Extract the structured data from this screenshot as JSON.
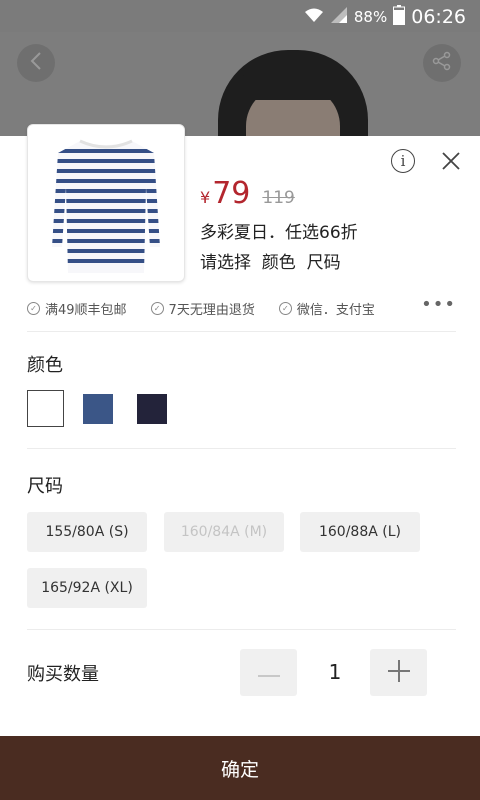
{
  "status_bar": {
    "battery": "88%",
    "time": "06:26"
  },
  "product": {
    "currency": "¥",
    "price": "79",
    "original_price": "119",
    "promo": "多彩夏日．任选66折",
    "selection_hint": "请选择  颜色  尺码"
  },
  "perks": [
    {
      "label": "满49顺丰包邮"
    },
    {
      "label": "7天无理由退货"
    },
    {
      "label": "微信．支付宝"
    }
  ],
  "more": "•••",
  "color_section": {
    "title": "颜色",
    "swatches": [
      {
        "color": "#ffffff",
        "selected": true
      },
      {
        "color": "#3b5687",
        "selected": false
      },
      {
        "color": "#23233a",
        "selected": false
      }
    ]
  },
  "size_section": {
    "title": "尺码",
    "sizes": [
      {
        "label": "155/80A (S)",
        "available": true
      },
      {
        "label": "160/84A (M)",
        "available": false
      },
      {
        "label": "160/88A (L)",
        "available": true
      },
      {
        "label": "165/92A (XL)",
        "available": true
      }
    ]
  },
  "quantity": {
    "label": "购买数量",
    "value": "1"
  },
  "confirm_label": "确定",
  "colors": {
    "accent_price": "#b3262e",
    "confirm_bg": "#4a2c21"
  }
}
